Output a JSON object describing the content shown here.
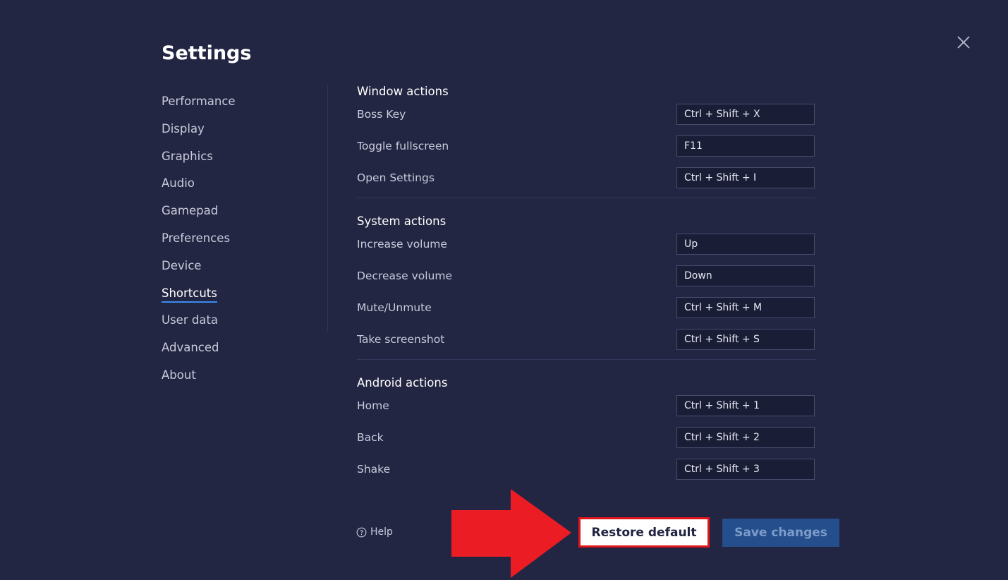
{
  "dialog": {
    "title": "Settings",
    "close_icon": "close-icon"
  },
  "nav": {
    "items": [
      {
        "label": "Performance"
      },
      {
        "label": "Display"
      },
      {
        "label": "Graphics"
      },
      {
        "label": "Audio"
      },
      {
        "label": "Gamepad"
      },
      {
        "label": "Preferences"
      },
      {
        "label": "Device"
      },
      {
        "label": "Shortcuts",
        "active": true
      },
      {
        "label": "User data"
      },
      {
        "label": "Advanced"
      },
      {
        "label": "About"
      }
    ]
  },
  "shortcuts": {
    "window_actions": {
      "title": "Window actions",
      "rows": [
        {
          "label": "Boss Key",
          "key": "Ctrl + Shift + X"
        },
        {
          "label": "Toggle fullscreen",
          "key": "F11"
        },
        {
          "label": "Open Settings",
          "key": "Ctrl + Shift + I"
        }
      ]
    },
    "system_actions": {
      "title": "System actions",
      "rows": [
        {
          "label": "Increase volume",
          "key": "Up"
        },
        {
          "label": "Decrease volume",
          "key": "Down"
        },
        {
          "label": "Mute/Unmute",
          "key": "Ctrl + Shift + M"
        },
        {
          "label": "Take screenshot",
          "key": "Ctrl + Shift + S"
        }
      ]
    },
    "android_actions": {
      "title": "Android actions",
      "rows": [
        {
          "label": "Home",
          "key": "Ctrl + Shift + 1"
        },
        {
          "label": "Back",
          "key": "Ctrl + Shift + 2"
        },
        {
          "label": "Shake",
          "key": "Ctrl + Shift + 3"
        }
      ]
    }
  },
  "footer": {
    "help_label": "Help",
    "help_icon": "help-circle-icon",
    "restore_label": "Restore default",
    "save_label": "Save changes"
  },
  "colors": {
    "background": "#232643",
    "accent": "#3b8cf0",
    "save_button": "#244f8c",
    "highlight_red": "#e0161b"
  }
}
